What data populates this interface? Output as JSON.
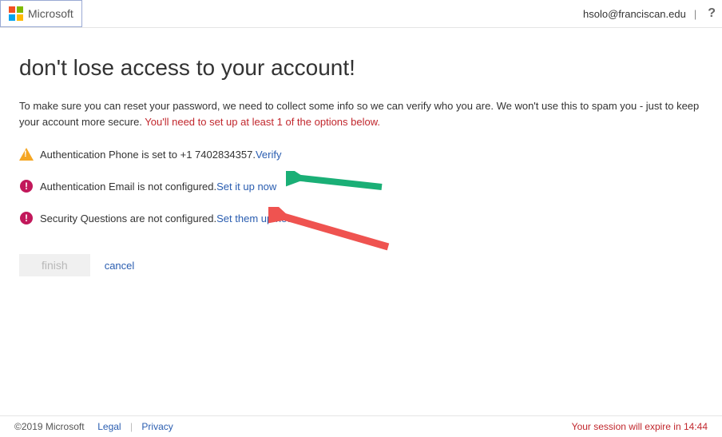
{
  "header": {
    "brand": "Microsoft",
    "user_email": "hsolo@franciscan.edu",
    "help_glyph": "?"
  },
  "page": {
    "title": "don't lose access to your account!",
    "intro_plain": "To make sure you can reset your password, we need to collect some info so we can verify who you are. We won't use this to spam you - just to keep your account more secure. ",
    "intro_emph": "You'll need to set up at least 1 of the options below."
  },
  "items": [
    {
      "text": "Authentication Phone is set to +1 7402834357. ",
      "action": "Verify"
    },
    {
      "text": "Authentication Email is not configured. ",
      "action": "Set it up now"
    },
    {
      "text": "Security Questions are not configured. ",
      "action": "Set them up now"
    }
  ],
  "actions": {
    "finish": "finish",
    "cancel": "cancel"
  },
  "footer": {
    "copyright": "©2019 Microsoft",
    "legal": "Legal",
    "privacy": "Privacy",
    "session": "Your session will expire in 14:44"
  }
}
